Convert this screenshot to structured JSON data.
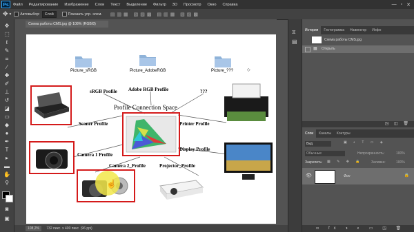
{
  "app": {
    "logo": "Ps"
  },
  "menu": [
    "Файл",
    "Редактирование",
    "Изображение",
    "Слои",
    "Текст",
    "Выделение",
    "Фильтр",
    "3D",
    "Просмотр",
    "Окно",
    "Справка"
  ],
  "options": {
    "autoselect": "Автовыбор:",
    "autoselect_value": "Слой",
    "show_controls": "Показать упр. элем."
  },
  "document": {
    "tab_title": "Схема работы CMS.jpg @ 108% (RGB/8)"
  },
  "status": {
    "zoom": "108,2%",
    "info": "732 пикс. х 400 пикс. (96 ppi)"
  },
  "diagram": {
    "folders": [
      "Picture_sRGB",
      "Picture_AdobeRGB",
      "Picture_???"
    ],
    "labels": {
      "srgb": "sRGB Profile",
      "adobe": "Adobe RGB Profile",
      "unknown": "???",
      "pcs": "Profile Connection Space",
      "scanner": "Scaner Profile",
      "printer": "Printer Profile",
      "camera1": "Camera 1 Profile",
      "display": "Display Profile",
      "camera2": "Camera 2_Profile",
      "projector": "Projector_Profile"
    }
  },
  "history_panel": {
    "tabs": [
      "История",
      "Гистограмма",
      "Навигатор",
      "Инфо"
    ],
    "snapshot": "Схема работы CMS.jpg",
    "step": "Открыть"
  },
  "layers_panel": {
    "tabs": [
      "Слои",
      "Каналы",
      "Контуры"
    ],
    "filter_placeholder": "Вид",
    "blend": "Обычные",
    "opacity_label": "Непрозрачность:",
    "opacity": "100%",
    "lock_label": "Закрепить:",
    "fill_label": "Заливка:",
    "fill": "100%",
    "layer_name": "Фон"
  },
  "colors": {
    "accent": "#31a8ff",
    "red": "#d41a1a",
    "highlight": "#f2e84a"
  }
}
